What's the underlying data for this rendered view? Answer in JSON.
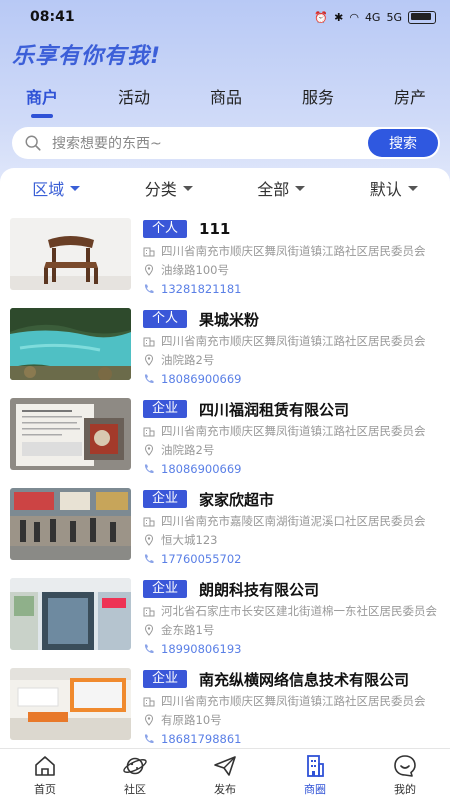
{
  "status_bar": {
    "time": "08:41",
    "network": "4G",
    "network2": "5G"
  },
  "header": {
    "slogan": "乐享有你有我!"
  },
  "tabs": [
    {
      "label": "商户",
      "active": true
    },
    {
      "label": "活动"
    },
    {
      "label": "商品"
    },
    {
      "label": "服务"
    },
    {
      "label": "房产"
    }
  ],
  "search": {
    "placeholder": "搜索想要的东西~",
    "button": "搜索"
  },
  "filters": [
    {
      "label": "区域",
      "active": true
    },
    {
      "label": "分类"
    },
    {
      "label": "全部"
    },
    {
      "label": "默认"
    }
  ],
  "merchants": [
    {
      "type": "个人",
      "name": "111",
      "address": "四川省南充市顺庆区舞凤街道镇江路社区居民委员会",
      "street": "油缘路100号",
      "phone": "13281821181",
      "image": "chair"
    },
    {
      "type": "个人",
      "name": "果城米粉",
      "address": "四川省南充市顺庆区舞凤街道镇江路社区居民委员会",
      "street": "油院路2号",
      "phone": "18086900669",
      "image": "lake"
    },
    {
      "type": "企业",
      "name": "四川福润租赁有限公司",
      "address": "四川省南充市顺庆区舞凤街道镇江路社区居民委员会",
      "street": "油院路2号",
      "phone": "18086900669",
      "image": "document"
    },
    {
      "type": "企业",
      "name": "家家欣超市",
      "address": "四川省南充市嘉陵区南湖街道泥溪口社区居民委员会",
      "street": "恒大城123",
      "phone": "17760055702",
      "image": "street"
    },
    {
      "type": "企业",
      "name": "朗朗科技有限公司",
      "address": "河北省石家庄市长安区建北街道棉一东社区居民委员会",
      "street": "金东路1号",
      "phone": "18990806193",
      "image": "shop"
    },
    {
      "type": "企业",
      "name": "南充纵横网络信息技术有限公司",
      "address": "四川省南充市顺庆区舞凤街道镇江路社区居民委员会",
      "street": "有原路10号",
      "phone": "18681798861",
      "image": "office"
    }
  ],
  "bottom_nav": [
    {
      "label": "首页",
      "icon": "home-icon"
    },
    {
      "label": "社区",
      "icon": "planet-icon"
    },
    {
      "label": "发布",
      "icon": "send-icon"
    },
    {
      "label": "商圈",
      "icon": "building-icon",
      "active": true
    },
    {
      "label": "我的",
      "icon": "smile-icon"
    }
  ],
  "colors": {
    "accent": "#2f52d6",
    "badge": "#3a57d8",
    "phone": "#5a7fe6"
  }
}
